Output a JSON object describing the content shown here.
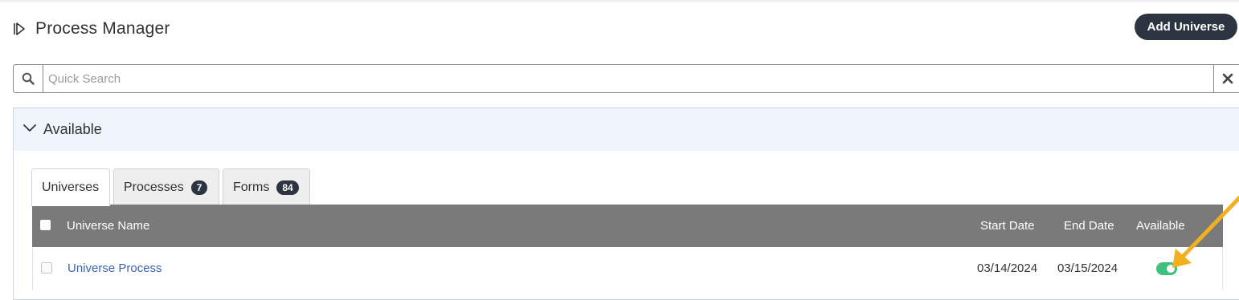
{
  "header": {
    "title": "Process Manager",
    "title_icon": "collapse-panel-icon",
    "add_button_label": "Add Universe"
  },
  "search": {
    "placeholder": "Quick Search",
    "value": "",
    "search_icon": "search-icon",
    "clear_icon": "close-icon"
  },
  "panel": {
    "title": "Available",
    "chevron_icon": "chevron-down-icon",
    "tabs": [
      {
        "label": "Universes",
        "count": null,
        "active": true
      },
      {
        "label": "Processes",
        "count": "7",
        "active": false
      },
      {
        "label": "Forms",
        "count": "84",
        "active": false
      }
    ]
  },
  "table": {
    "columns": {
      "name": "Universe Name",
      "start": "Start Date",
      "end": "End Date",
      "available": "Available"
    },
    "rows": [
      {
        "name": "Universe Process",
        "start": "03/14/2024",
        "end": "03/15/2024",
        "available": true
      }
    ]
  },
  "colors": {
    "dark": "#2b3440",
    "table_header": "#7a7a7a",
    "link": "#3a64b5",
    "toggle_on": "#3ec07e",
    "annotation_arrow": "#f0b020"
  }
}
